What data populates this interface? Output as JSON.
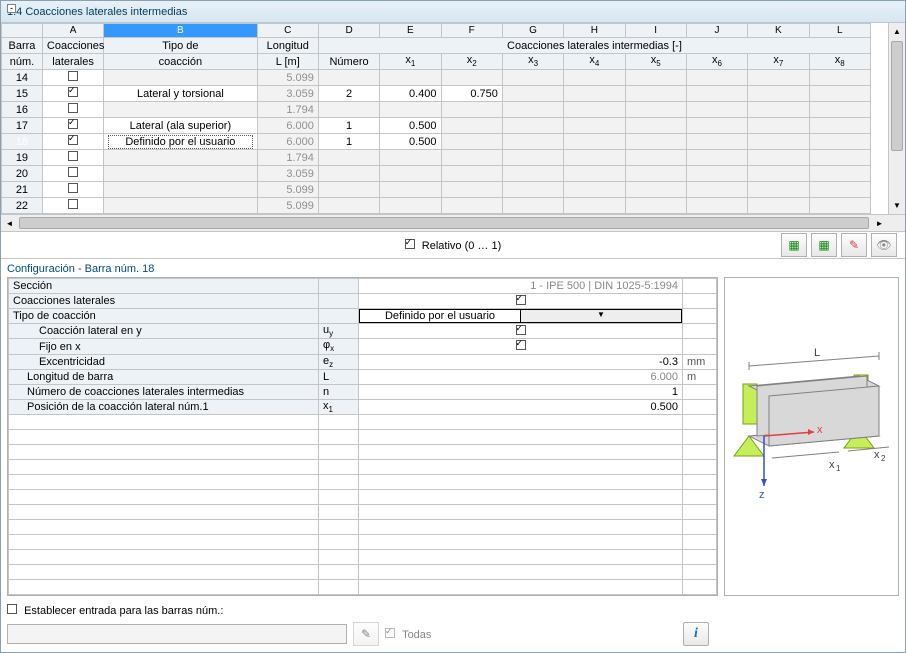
{
  "title": "1.4 Coacciones laterales intermedias",
  "grid": {
    "col_letters": [
      "A",
      "B",
      "C",
      "D",
      "E",
      "F",
      "G",
      "H",
      "I",
      "J",
      "K",
      "L"
    ],
    "headers_group_row1": {
      "barra": "Barra",
      "coacciones": "Coacciones",
      "tipo": "Tipo de",
      "longitud": "Longitud",
      "coacciones_lat": "Coacciones laterales intermedias [-]"
    },
    "headers_group_row2": {
      "num": "núm.",
      "laterales": "laterales",
      "coaccion": "coacción",
      "L": "L [m]",
      "numero": "Número",
      "x": [
        "x",
        "x",
        "x",
        "x",
        "x",
        "x",
        "x",
        "x"
      ],
      "x_sub": [
        "1",
        "2",
        "3",
        "4",
        "5",
        "6",
        "7",
        "8"
      ]
    },
    "rows": [
      {
        "id": "14",
        "chk": false,
        "tipo": "",
        "L": "5.099",
        "Lgray": true,
        "num": "",
        "vals": [
          "",
          "",
          "",
          "",
          "",
          "",
          "",
          ""
        ]
      },
      {
        "id": "15",
        "chk": true,
        "tipo": "Lateral y torsional",
        "L": "3.059",
        "Lgray": true,
        "num": "2",
        "vals": [
          "0.400",
          "0.750",
          "",
          "",
          "",
          "",
          "",
          ""
        ]
      },
      {
        "id": "16",
        "chk": false,
        "tipo": "",
        "L": "1.794",
        "Lgray": true,
        "num": "",
        "vals": [
          "",
          "",
          "",
          "",
          "",
          "",
          "",
          ""
        ]
      },
      {
        "id": "17",
        "chk": true,
        "tipo": "Lateral (ala superior)",
        "L": "6.000",
        "Lgray": true,
        "num": "1",
        "vals": [
          "0.500",
          "",
          "",
          "",
          "",
          "",
          "",
          ""
        ]
      },
      {
        "id": "18",
        "chk": true,
        "tipo": "Definido por el usuario",
        "tipo_combo": true,
        "L": "6.000",
        "Lgray": true,
        "num": "1",
        "vals": [
          "0.500",
          "",
          "",
          "",
          "",
          "",
          "",
          ""
        ],
        "selected": true
      },
      {
        "id": "19",
        "chk": false,
        "tipo": "",
        "L": "1.794",
        "Lgray": true,
        "num": "",
        "vals": [
          "",
          "",
          "",
          "",
          "",
          "",
          "",
          ""
        ]
      },
      {
        "id": "20",
        "chk": false,
        "tipo": "",
        "L": "3.059",
        "Lgray": true,
        "num": "",
        "vals": [
          "",
          "",
          "",
          "",
          "",
          "",
          "",
          ""
        ]
      },
      {
        "id": "21",
        "chk": false,
        "tipo": "",
        "L": "5.099",
        "Lgray": true,
        "num": "",
        "vals": [
          "",
          "",
          "",
          "",
          "",
          "",
          "",
          ""
        ]
      },
      {
        "id": "22",
        "chk": false,
        "tipo": "",
        "L": "5.099",
        "Lgray": true,
        "num": "",
        "vals": [
          "",
          "",
          "",
          "",
          "",
          "",
          "",
          ""
        ]
      }
    ]
  },
  "relative_label": "Relativo (0 … 1)",
  "relative_checked": true,
  "config_title_prefix": "Configuración - Barra núm. ",
  "config_member": "18",
  "props": [
    {
      "label": "Sección",
      "sym": "",
      "val": "1 - IPE 500 | DIN 1025-5:1994",
      "val_gray": true,
      "unit": "",
      "type": "text",
      "indent": 0
    },
    {
      "label": "Coacciones laterales",
      "sym": "",
      "val": "",
      "unit": "",
      "type": "check",
      "checked": true,
      "indent": 0
    },
    {
      "label": "Tipo de coacción",
      "sym": "",
      "val": "Definido por el usuario",
      "unit": "",
      "type": "combo",
      "indent": 0,
      "tree": "-"
    },
    {
      "label": "Coacción lateral en y",
      "sym": "u<sub>y</sub>",
      "val": "",
      "unit": "",
      "type": "check",
      "checked": true,
      "indent": 2
    },
    {
      "label": "Fijo en x",
      "sym": "φ<sub>x</sub>",
      "val": "",
      "unit": "",
      "type": "check",
      "checked": true,
      "indent": 2
    },
    {
      "label": "Excentricidad",
      "sym": "e<sub>z</sub>",
      "val": "-0.3",
      "unit": "mm",
      "type": "num",
      "indent": 2
    },
    {
      "label": "Longitud de barra",
      "sym": "L",
      "val": "6.000",
      "val_gray": true,
      "unit": "m",
      "type": "num",
      "indent": 1
    },
    {
      "label": "Número de coacciones laterales intermedias",
      "sym": "n",
      "val": "1",
      "unit": "",
      "type": "num",
      "indent": 1
    },
    {
      "label": "Posición de la coacción lateral núm.1",
      "sym": "x<sub>1</sub>",
      "val": "0.500",
      "unit": "",
      "type": "num",
      "indent": 1
    }
  ],
  "footer": {
    "set_input": "Establecer entrada para las barras núm.:",
    "todas": "Todas"
  },
  "preview_labels": {
    "L": "L",
    "x1": "x",
    "x1s": "1",
    "x2": "x",
    "x2s": "2",
    "z": "z",
    "x": "x"
  }
}
